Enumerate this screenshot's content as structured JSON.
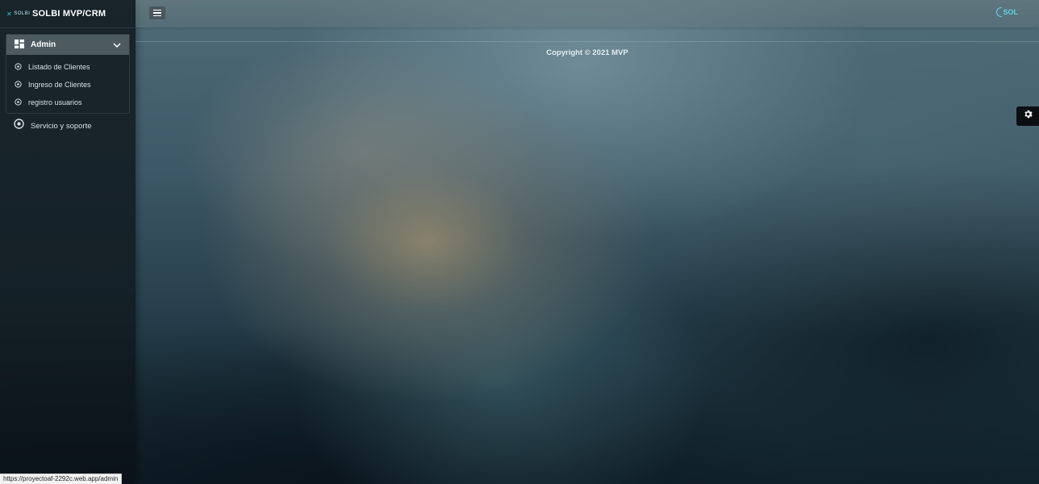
{
  "brand": {
    "logo_text": "SOLBI",
    "title": "SOLBI MVP/CRM"
  },
  "sidebar": {
    "group": {
      "label": "Admin",
      "icon": "dashboard-icon",
      "expanded": true,
      "items": [
        {
          "label": "Listado de Clientes",
          "icon": "circle-dot-icon"
        },
        {
          "label": "Ingreso de Clientes",
          "icon": "circle-dot-icon"
        },
        {
          "label": "registro usuarios",
          "icon": "circle-dot-icon"
        }
      ]
    },
    "items": [
      {
        "label": "Servicio y soporte",
        "icon": "circle-dot-icon"
      }
    ]
  },
  "topbar": {
    "menu_icon": "hamburger-icon",
    "logo_text": "SOL"
  },
  "footer": {
    "copyright": "Copyright © 2021 MVP"
  },
  "settings": {
    "icon": "gear-icon"
  },
  "status_bar": {
    "url": "https://proyectoaf-2292c.web.app/admin"
  },
  "colors": {
    "accent": "#25c5e8",
    "sidebar_bg": "#141e24",
    "active_group": "#5f6c73"
  }
}
